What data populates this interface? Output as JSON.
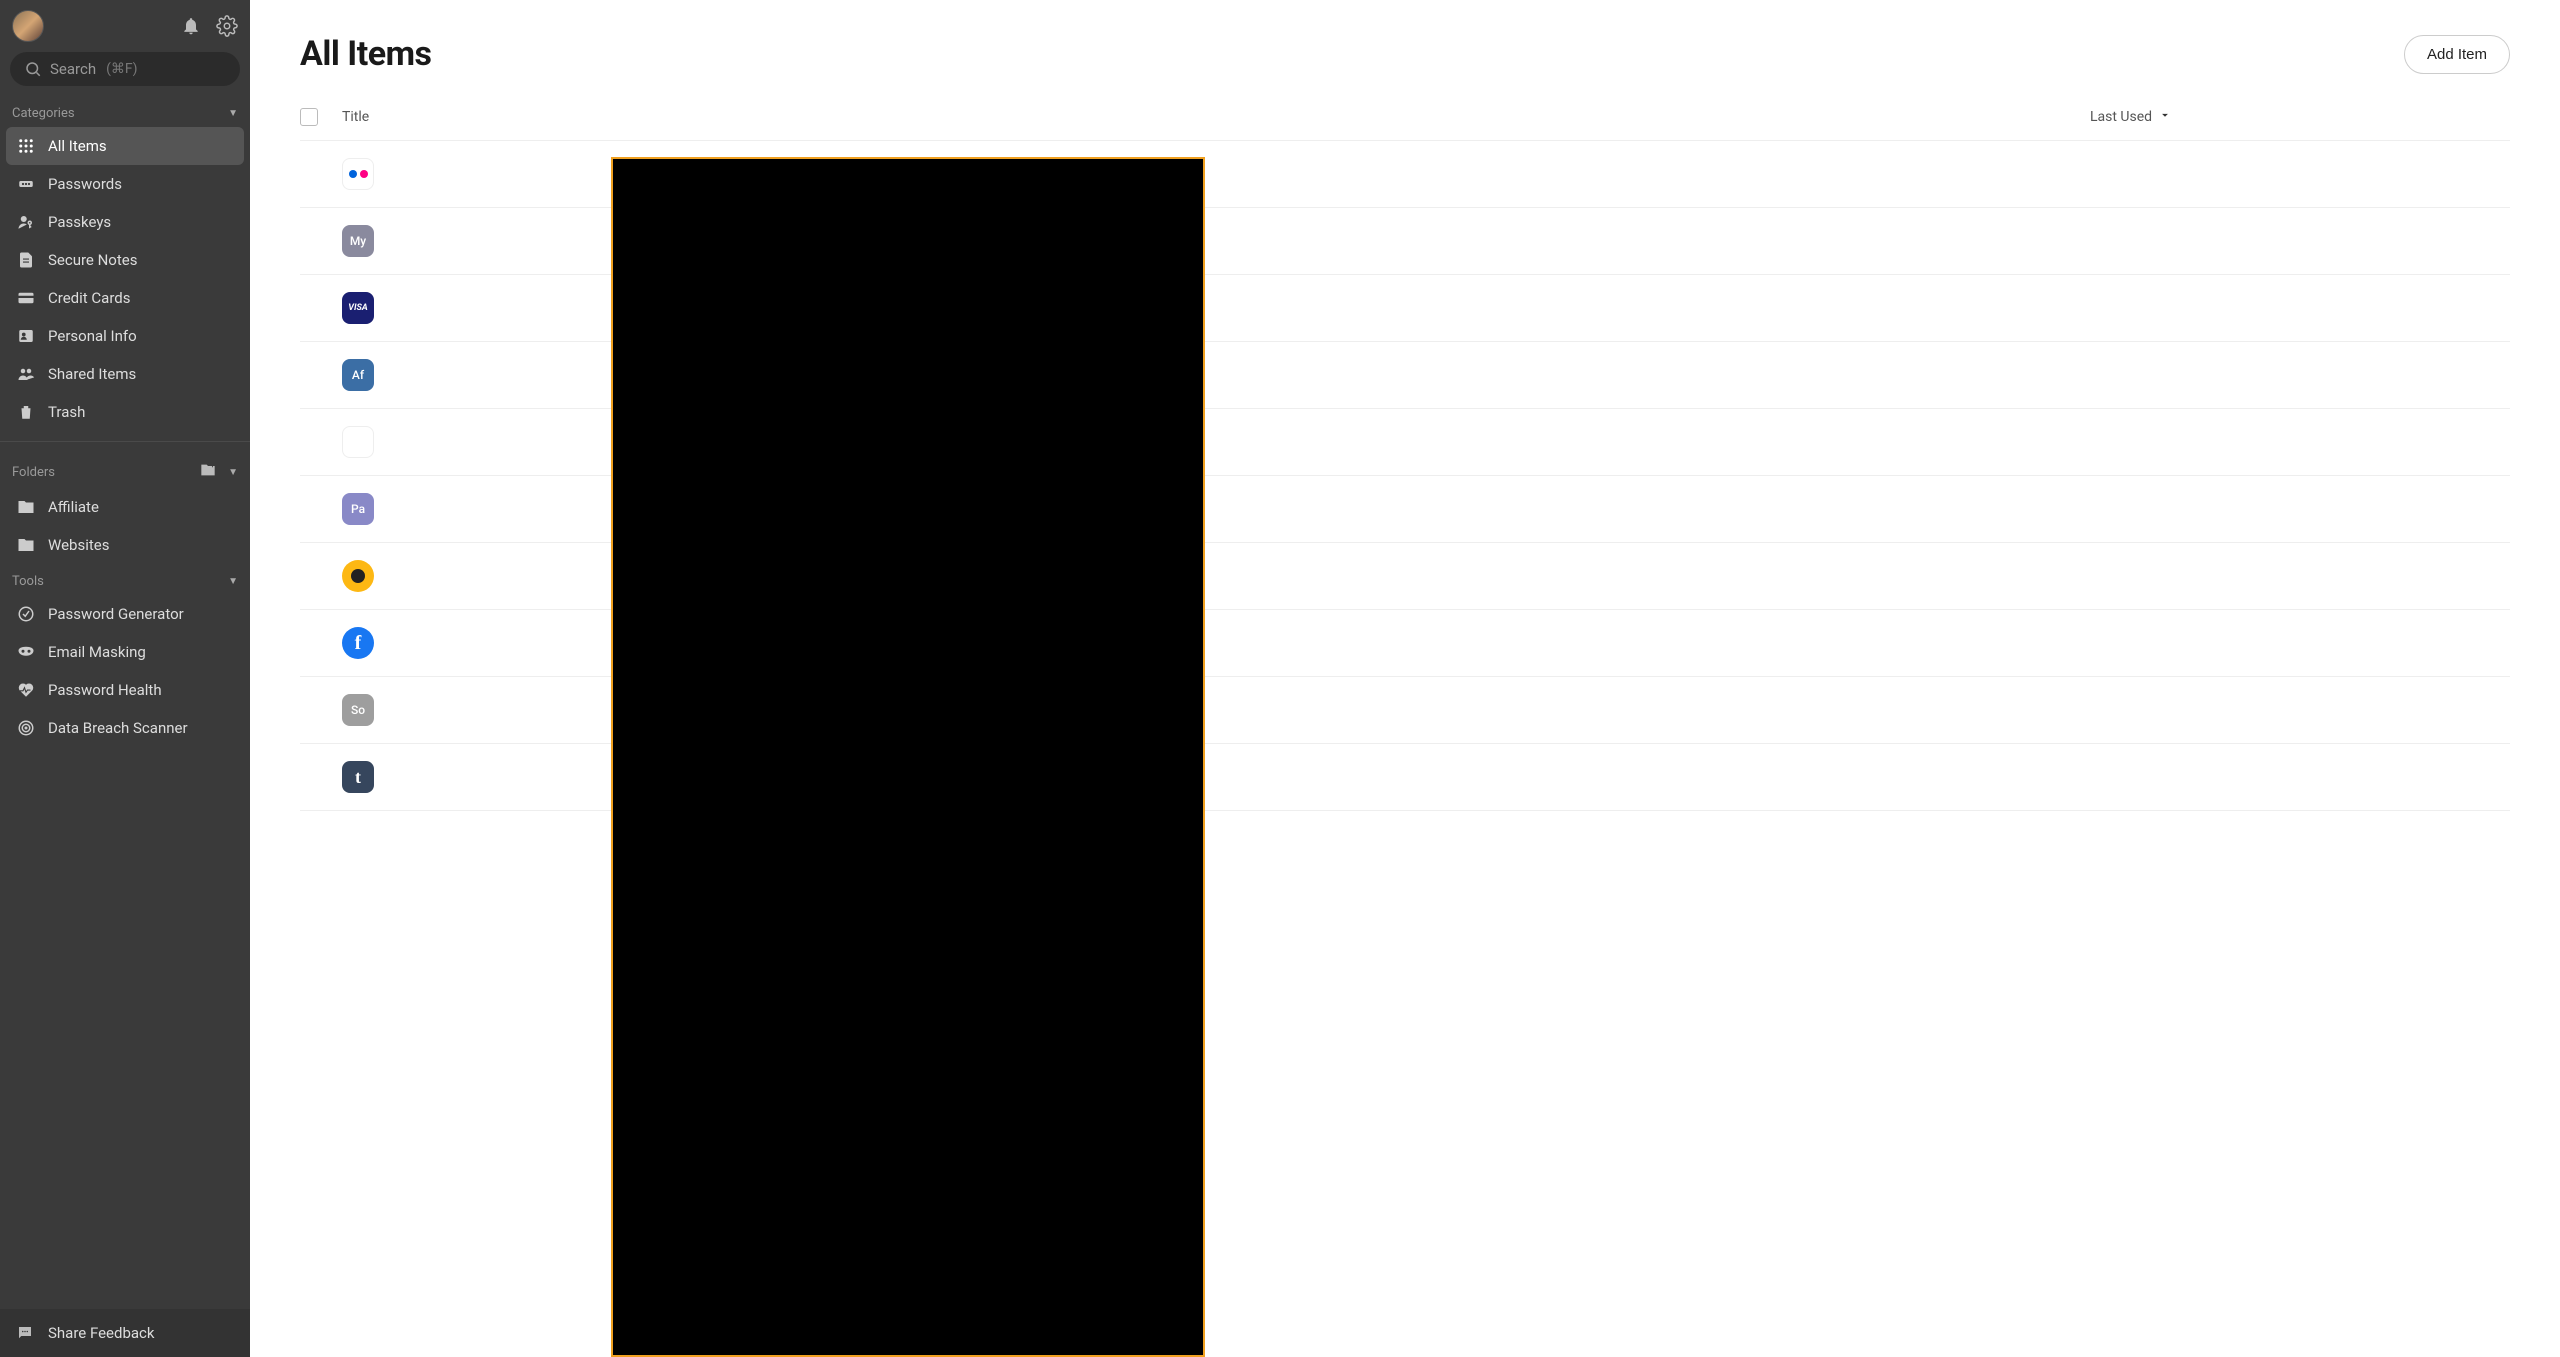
{
  "sidebar": {
    "search_label": "Search",
    "search_shortcut": "(⌘F)",
    "sections": {
      "categories": {
        "label": "Categories",
        "items": [
          {
            "label": "All Items"
          },
          {
            "label": "Passwords"
          },
          {
            "label": "Passkeys"
          },
          {
            "label": "Secure Notes"
          },
          {
            "label": "Credit Cards"
          },
          {
            "label": "Personal Info"
          },
          {
            "label": "Shared Items"
          },
          {
            "label": "Trash"
          }
        ]
      },
      "folders": {
        "label": "Folders",
        "items": [
          {
            "label": "Affiliate"
          },
          {
            "label": "Websites"
          }
        ]
      },
      "tools": {
        "label": "Tools",
        "items": [
          {
            "label": "Password Generator"
          },
          {
            "label": "Email Masking"
          },
          {
            "label": "Password Health"
          },
          {
            "label": "Data Breach Scanner"
          }
        ]
      }
    },
    "feedback_label": "Share Feedback"
  },
  "main": {
    "title": "All Items",
    "add_item_label": "Add Item",
    "columns": {
      "title": "Title",
      "last_used": "Last Used"
    },
    "items": [
      {
        "icon": "flickr",
        "icon_text": ""
      },
      {
        "icon": "my",
        "icon_text": "My"
      },
      {
        "icon": "visa",
        "icon_text": "VISA"
      },
      {
        "icon": "af",
        "icon_text": "Af"
      },
      {
        "icon": "microsoft",
        "icon_text": ""
      },
      {
        "icon": "pa",
        "icon_text": "Pa"
      },
      {
        "icon": "cyberghost",
        "icon_text": ""
      },
      {
        "icon": "facebook",
        "icon_text": "f"
      },
      {
        "icon": "so",
        "icon_text": "So"
      },
      {
        "icon": "tumblr",
        "icon_text": ""
      }
    ]
  }
}
